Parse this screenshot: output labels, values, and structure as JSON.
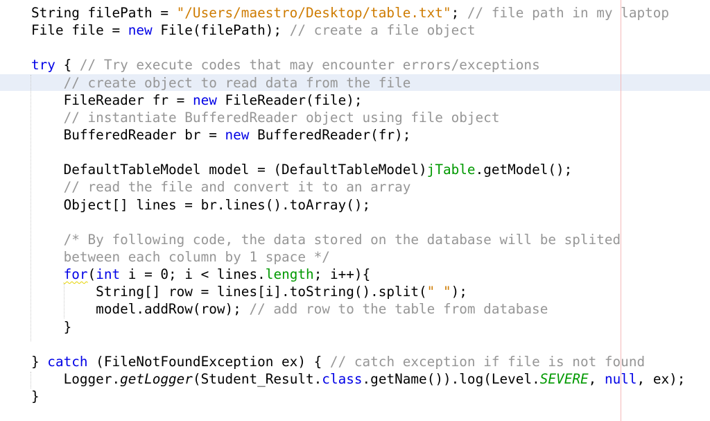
{
  "editor": {
    "language": "java",
    "current_line_index": 4,
    "colors": {
      "keyword": "#0000e6",
      "string": "#ce7b00",
      "comment": "#969696",
      "field": "#009900",
      "current_line": "#e8eef8",
      "margin_line": "#f4b8b8"
    },
    "lines": [
      {
        "indent": "",
        "tokens": [
          {
            "t": "String filePath = ",
            "c": "plain"
          },
          {
            "t": "\"/Users/maestro/Desktop/table.txt\"",
            "c": "str"
          },
          {
            "t": "; ",
            "c": "plain"
          },
          {
            "t": "// file path in my laptop",
            "c": "cm"
          }
        ]
      },
      {
        "indent": "",
        "tokens": [
          {
            "t": "File file = ",
            "c": "plain"
          },
          {
            "t": "new",
            "c": "kw"
          },
          {
            "t": " File(filePath); ",
            "c": "plain"
          },
          {
            "t": "// create a file object",
            "c": "cm"
          }
        ]
      },
      {
        "indent": "",
        "tokens": []
      },
      {
        "indent": "",
        "tokens": [
          {
            "t": "try",
            "c": "kw"
          },
          {
            "t": " { ",
            "c": "plain"
          },
          {
            "t": "// Try execute codes that may encounter errors/exceptions",
            "c": "cm"
          }
        ]
      },
      {
        "indent": "    ",
        "tokens": [
          {
            "t": "// create object to read data from the file",
            "c": "cm"
          }
        ]
      },
      {
        "indent": "    ",
        "tokens": [
          {
            "t": "FileReader fr = ",
            "c": "plain"
          },
          {
            "t": "new",
            "c": "kw"
          },
          {
            "t": " FileReader(file);",
            "c": "plain"
          }
        ]
      },
      {
        "indent": "    ",
        "tokens": [
          {
            "t": "// instantiate BufferedReader object using file object",
            "c": "cm"
          }
        ]
      },
      {
        "indent": "    ",
        "tokens": [
          {
            "t": "BufferedReader br = ",
            "c": "plain"
          },
          {
            "t": "new",
            "c": "kw"
          },
          {
            "t": " BufferedReader(fr);",
            "c": "plain"
          }
        ]
      },
      {
        "indent": "",
        "tokens": []
      },
      {
        "indent": "    ",
        "tokens": [
          {
            "t": "DefaultTableModel model = (DefaultTableModel)",
            "c": "plain"
          },
          {
            "t": "jTable",
            "c": "fld"
          },
          {
            "t": ".getModel();",
            "c": "plain"
          }
        ]
      },
      {
        "indent": "    ",
        "tokens": [
          {
            "t": "// read the file and convert it to an array",
            "c": "cm"
          }
        ]
      },
      {
        "indent": "    ",
        "tokens": [
          {
            "t": "Object[] lines = br.lines().toArray();",
            "c": "plain"
          }
        ]
      },
      {
        "indent": "",
        "tokens": []
      },
      {
        "indent": "    ",
        "tokens": [
          {
            "t": "/* By following code, the data stored on the database will be splited",
            "c": "cm"
          }
        ]
      },
      {
        "indent": "    ",
        "tokens": [
          {
            "t": "between each column by 1 space */",
            "c": "cm"
          }
        ]
      },
      {
        "indent": "    ",
        "tokens": [
          {
            "t": "for",
            "c": "kw warn"
          },
          {
            "t": "(",
            "c": "plain"
          },
          {
            "t": "int",
            "c": "kw"
          },
          {
            "t": " i = 0; i < lines.",
            "c": "plain"
          },
          {
            "t": "length",
            "c": "fld"
          },
          {
            "t": "; i++){",
            "c": "plain"
          }
        ]
      },
      {
        "indent": "        ",
        "tokens": [
          {
            "t": "String[] row = lines[i].toString().split(",
            "c": "plain"
          },
          {
            "t": "\" \"",
            "c": "str"
          },
          {
            "t": ");",
            "c": "plain"
          }
        ]
      },
      {
        "indent": "        ",
        "tokens": [
          {
            "t": "model.addRow(row); ",
            "c": "plain"
          },
          {
            "t": "// add row to the table from database",
            "c": "cm"
          }
        ]
      },
      {
        "indent": "    ",
        "tokens": [
          {
            "t": "}",
            "c": "plain"
          }
        ]
      },
      {
        "indent": "",
        "tokens": []
      },
      {
        "indent": "",
        "tokens": [
          {
            "t": "} ",
            "c": "plain"
          },
          {
            "t": "catch",
            "c": "kw"
          },
          {
            "t": " (FileNotFoundException ex) { ",
            "c": "plain"
          },
          {
            "t": "// catch exception if file is not found",
            "c": "cm"
          }
        ]
      },
      {
        "indent": "    ",
        "tokens": [
          {
            "t": "Logger.",
            "c": "plain"
          },
          {
            "t": "getLogger",
            "c": "it"
          },
          {
            "t": "(Student_Result.",
            "c": "plain"
          },
          {
            "t": "class",
            "c": "kw"
          },
          {
            "t": ".getName()).log(Level.",
            "c": "plain"
          },
          {
            "t": "SEVERE",
            "c": "fld it"
          },
          {
            "t": ", ",
            "c": "plain"
          },
          {
            "t": "null",
            "c": "kw"
          },
          {
            "t": ", ex);",
            "c": "plain"
          }
        ]
      },
      {
        "indent": "",
        "tokens": [
          {
            "t": "}",
            "c": "plain"
          }
        ]
      }
    ]
  }
}
